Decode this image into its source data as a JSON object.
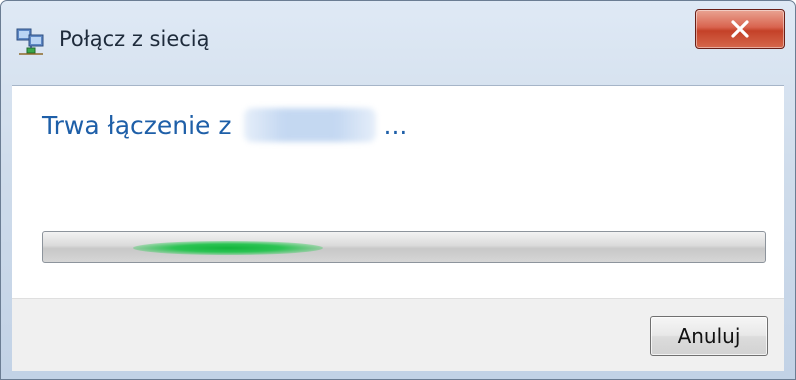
{
  "window": {
    "title": "Połącz z siecią",
    "close_label": "X"
  },
  "main": {
    "heading_prefix": "Trwa łączenie z",
    "network_name": "",
    "heading_suffix": "..."
  },
  "footer": {
    "cancel_label": "Anuluj"
  },
  "icons": {
    "app": "network-connect-icon",
    "close": "close-icon"
  },
  "colors": {
    "heading": "#1e5fa8",
    "progress_glow": "#13b53c",
    "close_button": "#c44128"
  }
}
